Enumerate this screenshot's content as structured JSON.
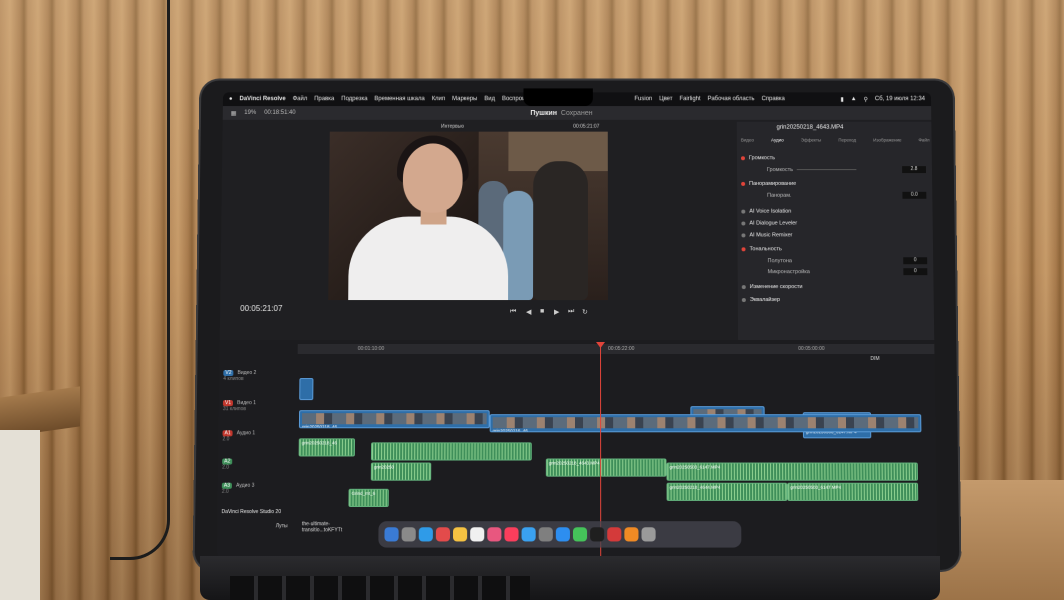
{
  "menu": {
    "app": "DaVinci Resolve",
    "items": [
      "Файл",
      "Правка",
      "Подрезка",
      "Временная шкала",
      "Клип",
      "Маркеры",
      "Вид",
      "Воспроизведение",
      "Fusion",
      "Цвет",
      "Fairlight",
      "Рабочая область",
      "Справка"
    ],
    "clock": "Сб, 19 июля 12:34"
  },
  "app_header": {
    "project": "Пушкин",
    "project_status": "Сохранен",
    "zoom": "19%",
    "left_timecode": "00:18:51:40"
  },
  "viewer": {
    "mode_label": "Интервью",
    "timecode": "00:05:21:07"
  },
  "inspector": {
    "clip_name": "grin20250218_4643.MP4",
    "tabs": [
      "Видео",
      "Аудио",
      "Эффекты",
      "Переход",
      "Изображение",
      "Файл"
    ],
    "active_tab": "Аудио",
    "sections": {
      "volume_title": "Громкость",
      "volume_label": "Громкость",
      "volume_value": "2.8",
      "pan_title": "Панорамирование",
      "pan_label": "Панорам.",
      "pan_value": "0.0",
      "voice_isolation": "AI Voice Isolation",
      "dialogue_leveler": "AI Dialogue Leveler",
      "music_remixer": "AI Music Remixer",
      "pitch_title": "Тональность",
      "semitones_label": "Полутона",
      "semitones_value": "0",
      "fine_label": "Микронастройка",
      "fine_value": "0",
      "speed_title": "Изменение скорости",
      "eq_title": "Эквалайзер"
    }
  },
  "timeline": {
    "timecode": "00:05:21:07",
    "ruler_marks": [
      "00:01:10:00",
      "00:05:22:00",
      "00:05:00:00"
    ],
    "level_label": "DIM",
    "tracks": [
      {
        "id": "V2",
        "name": "Видео 2",
        "info": "4 клипов"
      },
      {
        "id": "V1",
        "name": "Видео 1",
        "info": "31 клипов"
      },
      {
        "id": "A1",
        "name": "Аудио 1",
        "info": "2.0"
      },
      {
        "id": "A2",
        "name": "",
        "info": "2.0"
      },
      {
        "id": "A3",
        "name": "Аудио 3",
        "info": "2.0"
      }
    ],
    "clips": {
      "v1_first": "grin20250218_46",
      "v1_b": "grin20250218_4643.MP4",
      "v1_c": "grin20250503_6147.MP4",
      "v1_d": "grin20250216_46",
      "a1_first": "grin20250218_46",
      "a2_b": "grin20250",
      "a2_c": "grin20250218_4643.MP4",
      "a2_d": "grin20250503_6147.MP4",
      "a2_e": "grin20250218_4644.MP4",
      "a2_f": "grin20250503_6147.MP4",
      "a3_first": "Grind_mt_6"
    }
  },
  "overlay": {
    "brand": "DaVinci Resolve Studio 20",
    "left_label": "Луты",
    "middle_label": "the-ultimate-transitio...toKFYTt"
  }
}
